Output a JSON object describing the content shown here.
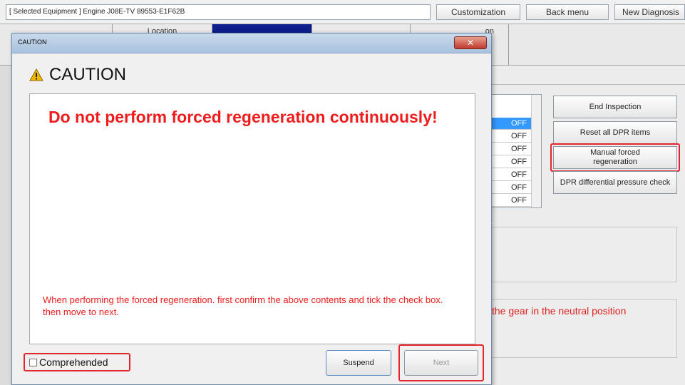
{
  "top": {
    "equipment": "[ Selected Equipment ] Engine J08E-TV 89553-E1F62B",
    "buttons": [
      "Customization",
      "Back menu",
      "New Diagnosis"
    ]
  },
  "bg_tabs": [
    "",
    "Location",
    "",
    "",
    "on"
  ],
  "right": {
    "off_values": [
      "OFF",
      "OFF",
      "OFF",
      "OFF",
      "OFF",
      "OFF",
      "OFF"
    ],
    "buttons": [
      "End Inspection",
      "Reset all DPR items",
      "Manual forced regeneration",
      "DPR differential pressure check"
    ],
    "neutral_text": "the gear in the neutral position"
  },
  "dialog": {
    "title": "CAUTION",
    "close_symbol": "✕",
    "heading": "CAUTION",
    "main_message": "Do not perform forced regeneration continuously!",
    "sub_message": "When performing the forced regeneration. first confirm the above contents and tick the check box. then move to next.",
    "checkbox_label": "Comprehended",
    "checkbox_checked": false,
    "suspend_label": "Suspend",
    "next_label": "Next",
    "next_enabled": false
  },
  "colors": {
    "warning_red": "#ee1c1c",
    "highlight_frame": "#e3262c",
    "selected_blue": "#3399ff"
  },
  "icons": {
    "warning": "warning-triangle-icon",
    "close": "close-icon"
  }
}
